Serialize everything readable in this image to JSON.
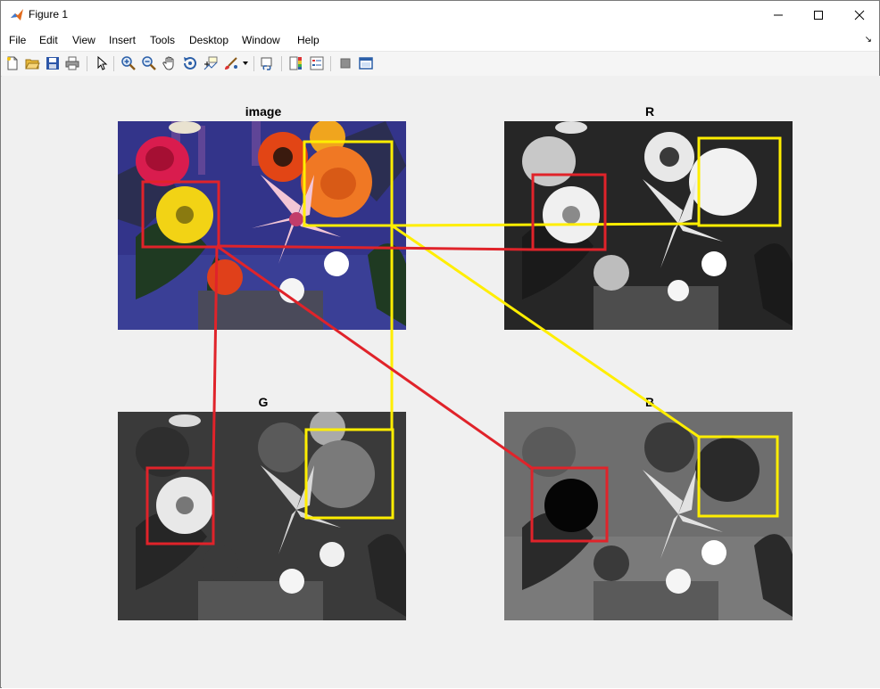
{
  "window": {
    "title": "Figure 1"
  },
  "menu": [
    "File",
    "Edit",
    "View",
    "Insert",
    "Tools",
    "Desktop",
    "Window",
    "Help"
  ],
  "toolbar": {
    "buttons": [
      "new-figure-icon",
      "open-file-icon",
      "save-icon",
      "print-icon",
      "edit-plot-icon",
      "zoom-in-icon",
      "zoom-out-icon",
      "pan-icon",
      "rotate-3d-icon",
      "data-cursor-icon",
      "brush-icon",
      "link-plot-icon",
      "colorbar-icon",
      "legend-icon",
      "hide-plot-tools-icon",
      "show-plot-tools-icon"
    ]
  },
  "axes": [
    {
      "title": "image",
      "channel": "color"
    },
    {
      "title": "R",
      "channel": "red"
    },
    {
      "title": "G",
      "channel": "green"
    },
    {
      "title": "B",
      "channel": "blue"
    }
  ],
  "colors": {
    "red_box": "#e0232a",
    "yellow_box": "#ffee00"
  }
}
